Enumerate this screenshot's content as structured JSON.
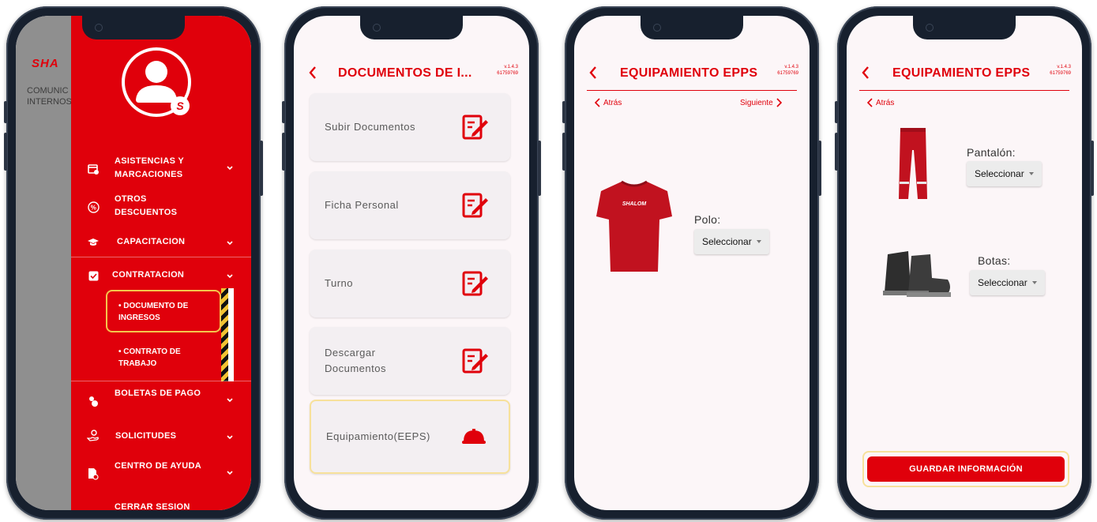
{
  "phone1": {
    "logo": "SHA",
    "side_text": [
      "COMUNIC",
      "INTERNOS"
    ],
    "menu": [
      {
        "label": "ASISTENCIAS Y MARCACIONES",
        "icon": "calendar-icon"
      },
      {
        "label": "OTROS DESCUENTOS",
        "icon": "percent-icon"
      },
      {
        "label": "CAPACITACION",
        "icon": "graduation-cap-icon"
      },
      {
        "label": "CONTRATACION",
        "icon": "checkbox-icon"
      },
      {
        "label": "BOLETAS DE PAGO",
        "icon": "coins-icon"
      },
      {
        "label": "SOLICITUDES",
        "icon": "hand-coin-icon"
      },
      {
        "label": "CENTRO DE AYUDA",
        "icon": "document-search-icon"
      },
      {
        "label": "CERRAR SESION"
      }
    ],
    "submenu": [
      "DOCUMENTO DE INGRESOS",
      "CONTRATO DE TRABAJO"
    ]
  },
  "phone2": {
    "title": "DOCUMENTOS DE I...",
    "version": "v.1.4.3",
    "user_id": "61759769",
    "cards": [
      {
        "label": "Subir Documentos",
        "icon": "edit-document-icon"
      },
      {
        "label": "Ficha Personal",
        "icon": "edit-document-icon"
      },
      {
        "label": "Turno",
        "icon": "edit-document-icon"
      },
      {
        "label": "Descargar Documentos",
        "icon": "edit-document-icon"
      },
      {
        "label": "Equipamiento(EEPS)",
        "icon": "hard-hat-icon"
      }
    ]
  },
  "phone3": {
    "title": "EQUIPAMIENTO EPPS",
    "version": "v.1.4.3",
    "user_id": "61759769",
    "back_label": "Atrás",
    "next_label": "Siguiente",
    "item_label": "Polo:",
    "select_value": "Seleccionar",
    "shirt_logo": "SHALOM"
  },
  "phone4": {
    "title": "EQUIPAMIENTO EPPS",
    "version": "v.1.4.3",
    "user_id": "61759769",
    "back_label": "Atrás",
    "pants_label": "Pantalón:",
    "pants_select": "Seleccionar",
    "boots_label": "Botas:",
    "boots_select": "Seleccionar",
    "save_label": "GUARDAR INFORMACIÓN"
  },
  "colors": {
    "accent": "#e0000b",
    "highlight": "#f4c64c",
    "phone_frame": "#17202e"
  }
}
